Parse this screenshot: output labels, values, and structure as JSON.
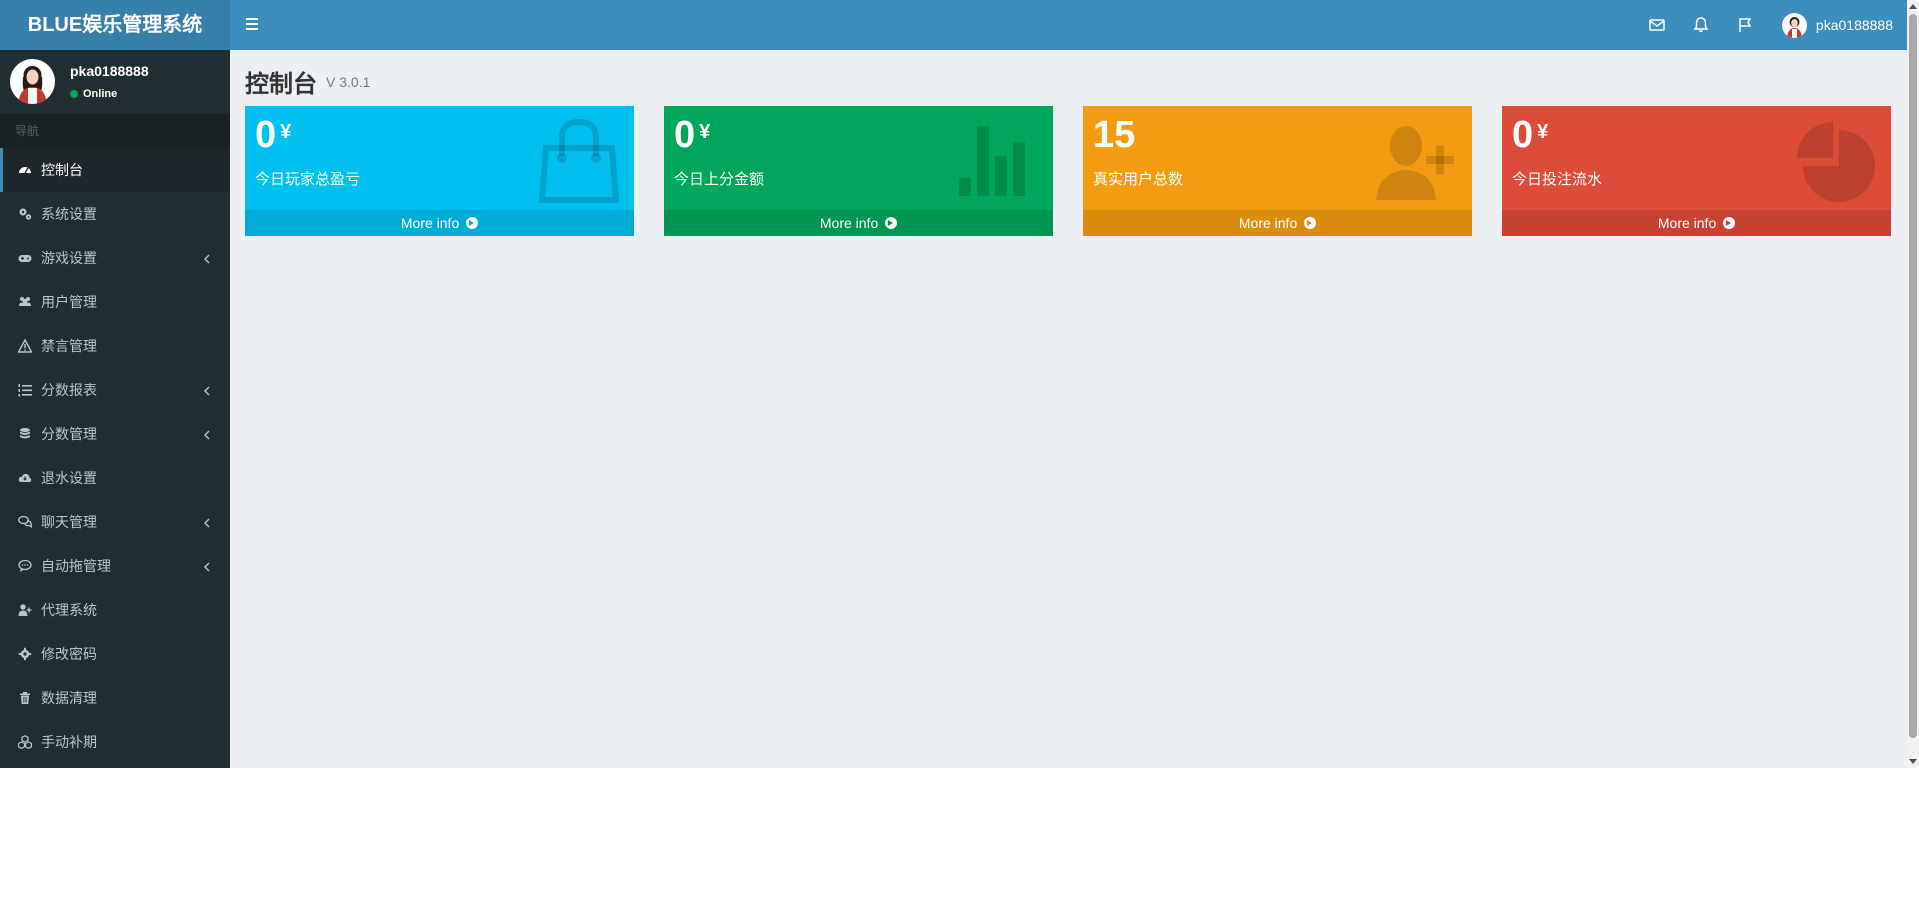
{
  "app": {
    "logo": "BLUE娱乐管理系统",
    "user": {
      "name": "pka0188888",
      "status": "Online"
    }
  },
  "sidebar": {
    "nav_header": "导航",
    "items": [
      {
        "label": "控制台",
        "icon": "dashboard-icon",
        "active": true,
        "has_children": false
      },
      {
        "label": "系统设置",
        "icon": "gears-icon",
        "active": false,
        "has_children": false
      },
      {
        "label": "游戏设置",
        "icon": "gamepad-icon",
        "active": false,
        "has_children": true
      },
      {
        "label": "用户管理",
        "icon": "users-icon",
        "active": false,
        "has_children": false
      },
      {
        "label": "禁言管理",
        "icon": "warning-icon",
        "active": false,
        "has_children": false
      },
      {
        "label": "分数报表",
        "icon": "list-ol-icon",
        "active": false,
        "has_children": true
      },
      {
        "label": "分数管理",
        "icon": "database-icon",
        "active": false,
        "has_children": true
      },
      {
        "label": "退水设置",
        "icon": "cloud-download-icon",
        "active": false,
        "has_children": false
      },
      {
        "label": "聊天管理",
        "icon": "comments-icon",
        "active": false,
        "has_children": true
      },
      {
        "label": "自动拖管理",
        "icon": "commenting-icon",
        "active": false,
        "has_children": true
      },
      {
        "label": "代理系统",
        "icon": "user-plus-icon",
        "active": false,
        "has_children": false
      },
      {
        "label": "修改密码",
        "icon": "cog-icon",
        "active": false,
        "has_children": false
      },
      {
        "label": "数据清理",
        "icon": "trash-icon",
        "active": false,
        "has_children": false
      },
      {
        "label": "手动补期",
        "icon": "cubes-icon",
        "active": false,
        "has_children": false
      }
    ]
  },
  "header": {
    "icons": [
      "envelope-icon",
      "bell-icon",
      "flag-icon"
    ]
  },
  "page": {
    "title": "控制台",
    "version": "V 3.0.1"
  },
  "boxes": [
    {
      "value": "0",
      "currency": "¥",
      "label": "今日玩家总盈亏",
      "more": "More info",
      "color": "#00c0ef",
      "foot_color": "#00acd6",
      "icon": "shopping-bag-icon"
    },
    {
      "value": "0",
      "currency": "¥",
      "label": "今日上分金额",
      "more": "More info",
      "color": "#00a65a",
      "foot_color": "#009551",
      "icon": "bar-chart-icon"
    },
    {
      "value": "15",
      "currency": "",
      "label": "真实用户总数",
      "more": "More info",
      "color": "#f39c12",
      "foot_color": "#da8c10",
      "icon": "user-plus-icon"
    },
    {
      "value": "0",
      "currency": "¥",
      "label": "今日投注流水",
      "more": "More info",
      "color": "#dd4b39",
      "foot_color": "#c64333",
      "icon": "pie-chart-icon"
    }
  ]
}
